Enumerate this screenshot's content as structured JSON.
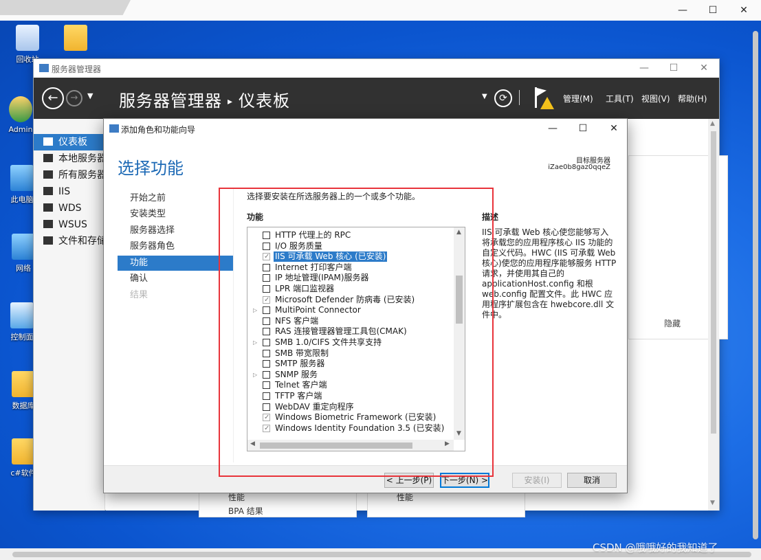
{
  "host": {
    "controls": {
      "minimize": "—",
      "maximize": "☐",
      "close": "✕"
    }
  },
  "desktop_icons": [
    {
      "label": "回收站"
    },
    {
      "label": ""
    },
    {
      "label": "Admin"
    },
    {
      "label": "此电脑"
    },
    {
      "label": "网络"
    },
    {
      "label": "控制面"
    },
    {
      "label": "数据库"
    },
    {
      "label": "c#软件"
    }
  ],
  "server_manager": {
    "window_title": "服务器管理器",
    "breadcrumb": {
      "app": "服务器管理器",
      "page": "仪表板"
    },
    "menus": [
      "管理(M)",
      "工具(T)",
      "视图(V)",
      "帮助(H)"
    ],
    "nav": [
      {
        "label": "仪表板",
        "active": true
      },
      {
        "label": "本地服务器"
      },
      {
        "label": "所有服务器"
      },
      {
        "label": "IIS"
      },
      {
        "label": "WDS"
      },
      {
        "label": "WSUS"
      },
      {
        "label": "文件和存储"
      }
    ],
    "tile_hide": "隐藏",
    "tile_texts": {
      "perf_left": "性能",
      "perf_right": "性能",
      "bpa": "BPA 结果"
    }
  },
  "wizard": {
    "window_title": "添加角色和功能向导",
    "heading": "选择功能",
    "target_server_label": "目标服务器",
    "target_server_value": "iZae0b8gaz0qqeZ",
    "steps": [
      {
        "label": "开始之前"
      },
      {
        "label": "安装类型"
      },
      {
        "label": "服务器选择"
      },
      {
        "label": "服务器角色"
      },
      {
        "label": "功能",
        "active": true
      },
      {
        "label": "确认"
      },
      {
        "label": "结果",
        "disabled": true
      }
    ],
    "instruction": "选择要安装在所选服务器上的一个或多个功能。",
    "features_label": "功能",
    "description_label": "描述",
    "description_text": "IIS 可承载 Web 核心使您能够写入将承载您的应用程序核心 IIS 功能的自定义代码。HWC (IIS 可承载 Web 核心)使您的应用程序能够服务 HTTP 请求，并使用其自己的 applicationHost.config 和根 web.config 配置文件。此 HWC 应用程序扩展包含在 hwebcore.dll 文件中。",
    "features": [
      {
        "label": "HTTP 代理上的 RPC",
        "checked": false
      },
      {
        "label": "I/O 服务质量",
        "checked": false
      },
      {
        "label": "IIS 可承载 Web 核心 (已安装)",
        "checked": true,
        "selected": true
      },
      {
        "label": "Internet 打印客户端",
        "checked": false
      },
      {
        "label": "IP 地址管理(IPAM)服务器",
        "checked": false
      },
      {
        "label": "LPR 端口监视器",
        "checked": false
      },
      {
        "label": "Microsoft Defender 防病毒 (已安装)",
        "checked": true
      },
      {
        "label": "MultiPoint Connector",
        "checked": false,
        "expandable": true
      },
      {
        "label": "NFS 客户端",
        "checked": false
      },
      {
        "label": "RAS 连接管理器管理工具包(CMAK)",
        "checked": false
      },
      {
        "label": "SMB 1.0/CIFS 文件共享支持",
        "checked": false,
        "expandable": true
      },
      {
        "label": "SMB 带宽限制",
        "checked": false
      },
      {
        "label": "SMTP 服务器",
        "checked": false
      },
      {
        "label": "SNMP 服务",
        "checked": false,
        "expandable": true
      },
      {
        "label": "Telnet 客户端",
        "checked": false
      },
      {
        "label": "TFTP 客户端",
        "checked": false
      },
      {
        "label": "WebDAV 重定向程序",
        "checked": false
      },
      {
        "label": "Windows Biometric Framework (已安装)",
        "checked": true
      },
      {
        "label": "Windows Identity Foundation 3.5 (已安装)",
        "checked": true
      }
    ],
    "buttons": {
      "prev": "< 上一步(P)",
      "next": "下一步(N) >",
      "install": "安装(I)",
      "cancel": "取消"
    }
  },
  "watermark": "CSDN @哦哦好的我知道了",
  "colors": {
    "accent": "#2c7bc9",
    "header_dark": "#313131",
    "highlight_box": "#e8333a"
  }
}
